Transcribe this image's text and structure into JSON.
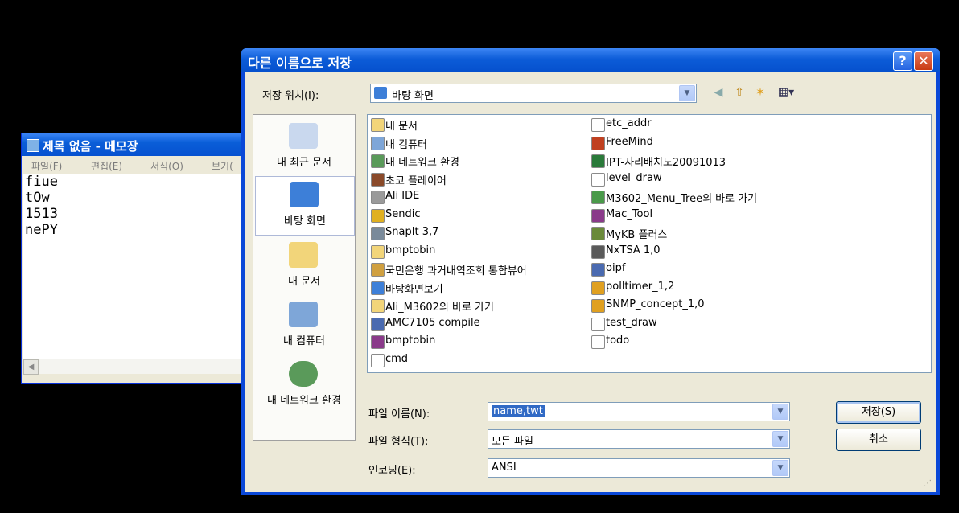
{
  "notepad": {
    "title": "제목 없음 - 메모장",
    "menu": [
      "파일(F)",
      "편집(E)",
      "서식(O)",
      "보기("
    ],
    "lines": [
      "fiue",
      "tOw",
      "1513",
      "nePY"
    ]
  },
  "dialog": {
    "title": "다른 이름으로 저장",
    "help_label": "?",
    "close_label": "✕",
    "save_in_label": "저장 위치(I):",
    "save_in_value": "바탕 화면",
    "places": [
      "내 최근 문서",
      "바탕 화면",
      "내 문서",
      "내 컴퓨터",
      "내 네트워크 환경"
    ],
    "files_col1": [
      "내 문서",
      "내 컴퓨터",
      "내 네트워크 환경",
      "초코 플레이어",
      "Ali IDE",
      "Sendic",
      "SnapIt 3,7",
      "bmptobin",
      "국민은행 과거내역조회 통합뷰어",
      "바탕화면보기",
      "Ali_M3602의 바로 가기",
      "AMC7105 compile",
      "bmptobin",
      "cmd"
    ],
    "files_col2": [
      "etc_addr",
      "FreeMind",
      "IPT-자리배치도20091013",
      "level_draw",
      "M3602_Menu_Tree의 바로 가기",
      "Mac_Tool",
      "MyKB 플러스",
      "NxTSA 1,0",
      "oipf",
      "polltimer_1,2",
      "SNMP_concept_1,0",
      "test_draw",
      "todo"
    ],
    "file_name_label": "파일 이름(N):",
    "file_name_value": "name,twt",
    "file_type_label": "파일 형식(T):",
    "file_type_value": "모든 파일",
    "encoding_label": "인코딩(E):",
    "encoding_value": "ANSI",
    "save_button": "저장(S)",
    "cancel_button": "취소"
  },
  "colors": {
    "titlebar": "#0a5ed8",
    "selection": "#316ac5",
    "dialog_face": "#ece9d8"
  }
}
